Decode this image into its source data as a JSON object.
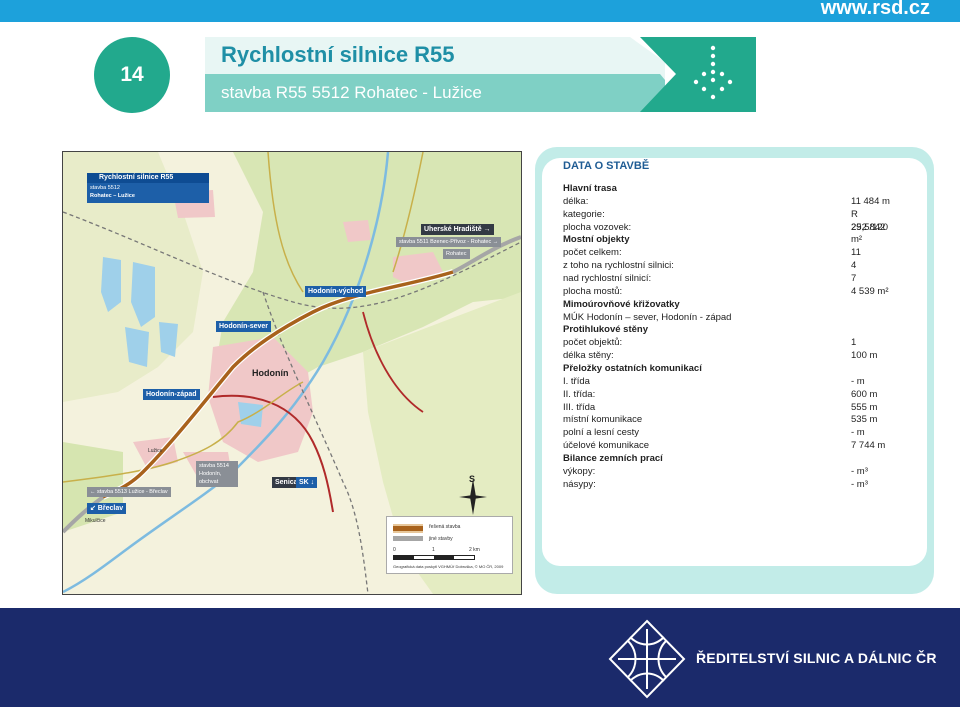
{
  "header": {
    "website": "www.rsd.cz",
    "number": "14",
    "title": "Rychlostní silnice R55",
    "subtitle": "stavba R55 5512 Rohatec - Lužice"
  },
  "map": {
    "box_title": "Rychlostní silnice R55",
    "box_line1": "stavba 5512",
    "box_line2": "Rohatec – Lužice",
    "labels": {
      "uherske": "Uherské Hradiště →",
      "stavba5511": "stavba 5511 Bzenec-Přívoz - Rohatec →",
      "rohatec": "Rohatec",
      "hodonin_vychod": "Hodonín-východ",
      "hodonin_sever": "Hodonín-sever",
      "hodonin_zapad": "Hodonín-západ",
      "hodonin_city": "Hodonín",
      "senica": "Senica",
      "senica_sk": "SK ↓",
      "stavba5513": "← stavba 5513 Lužice - Břeclav",
      "stavba5514": "stavba 5514 Hodonín, obchvat",
      "breclav": "↙ Břeclav",
      "luzice": "Lužice",
      "mikulcice": "Mikulčice",
      "north": "S"
    },
    "legend": {
      "item1": "řešená stavba",
      "item2": "jiné stavby",
      "scale0": "0",
      "scale1": "1",
      "scale2": "2 km",
      "credit": "Geografická data poskytl VGHMÚř Dobruška, © MO ČR, 2009"
    }
  },
  "panel": {
    "title": "DATA O STAVBĚ",
    "rows": [
      {
        "label": "Hlavní trasa",
        "value": "",
        "heading": true
      },
      {
        "label": "délka:",
        "value": "11 484 m"
      },
      {
        "label": "kategorie:",
        "value": "R 25,5/120"
      },
      {
        "label": "plocha vozovek:",
        "value": "292 842 m²"
      },
      {
        "label": "Mostní objekty",
        "value": "",
        "heading": true
      },
      {
        "label": "počet celkem:",
        "value": "11"
      },
      {
        "label": "z toho na rychlostní silnici:",
        "value": "4"
      },
      {
        "label": "nad rychlostní silnicí:",
        "value": "7"
      },
      {
        "label": "plocha mostů:",
        "value": "4 539 m²"
      },
      {
        "label": "Mimoúrovňové křižovatky",
        "value": "",
        "heading": true
      },
      {
        "label": "MÚK Hodonín – sever, Hodonín - západ",
        "value": ""
      },
      {
        "label": "Protihlukové stěny",
        "value": "",
        "heading": true
      },
      {
        "label": "počet objektů:",
        "value": "1"
      },
      {
        "label": "délka stěny:",
        "value": "100 m"
      },
      {
        "label": "Přeložky ostatních komunikací",
        "value": "",
        "heading": true
      },
      {
        "label": "I. třída",
        "value": "- m"
      },
      {
        "label": "II. třída:",
        "value": "600 m"
      },
      {
        "label": "III. třída",
        "value": "555 m"
      },
      {
        "label": "místní komunikace",
        "value": "535 m"
      },
      {
        "label": "polní a lesní cesty",
        "value": "- m"
      },
      {
        "label": "účelové komunikace",
        "value": "7 744  m"
      },
      {
        "label": "Bilance zemních prací",
        "value": "",
        "heading": true
      },
      {
        "label": "výkopy:",
        "value": "- m³"
      },
      {
        "label": "násypy:",
        "value": "- m³"
      }
    ]
  },
  "footer": {
    "org": "ŘEDITELSTVÍ SILNIC A DÁLNIC ČR"
  }
}
